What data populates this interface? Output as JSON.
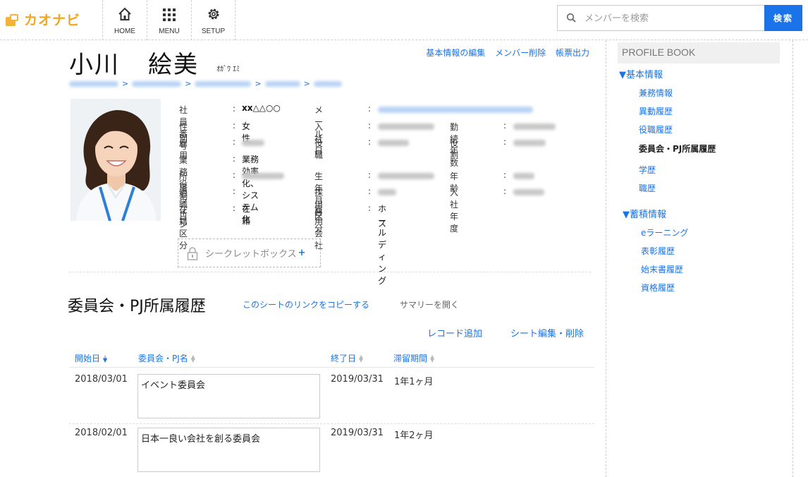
{
  "header": {
    "logo_text": "カオナビ",
    "nav": [
      {
        "label": "HOME",
        "icon": "home-icon"
      },
      {
        "label": "MENU",
        "icon": "grid-icon"
      },
      {
        "label": "SETUP",
        "icon": "gear-icon"
      }
    ],
    "search": {
      "placeholder": "メンバーを検索",
      "value": "",
      "button_label": "検索"
    }
  },
  "profile": {
    "name_family": "小川",
    "name_given": "絵美",
    "name_kana": "ｵｶﾞﾜ ｴﾐ",
    "actions": [
      "基本情報の編集",
      "メンバー削除",
      "帳票出力"
    ],
    "breadcrumb_separator": ">",
    "fields": {
      "employee_no": {
        "label": "社員番号",
        "value": "xx△△○○"
      },
      "email": {
        "label": "メール"
      },
      "gender": {
        "label": "性別",
        "value": "女性"
      },
      "join_date": {
        "label": "入社日"
      },
      "years": {
        "label": "勤続年数"
      },
      "employment": {
        "label": "雇用"
      },
      "position": {
        "label": "役職"
      },
      "role": {
        "label": "役割"
      },
      "duty": {
        "label": "業務役割",
        "value": "業務効率化、システム化"
      },
      "line": {
        "label": "所属ライン"
      },
      "birthday": {
        "label": "生年月日"
      },
      "age": {
        "label": "年齢"
      },
      "retire": {
        "label": "退職日",
        "value": ""
      },
      "hire_type": {
        "label": "採用区分"
      },
      "join_year": {
        "label": "入社年度"
      },
      "status": {
        "label": "在籍区分",
        "value": "在籍"
      },
      "company": {
        "label": "雇用会社",
        "value_line1": "ホールディング",
        "value_line2": "ス"
      }
    },
    "colon": ":",
    "secret_box": {
      "label": "シークレットボックス",
      "plus": "+"
    }
  },
  "sheet": {
    "title": "委員会・PJ所属履歴",
    "copy_link": "このシートのリンクをコピーする",
    "summary": "サマリーを開く",
    "add_record": "レコード追加",
    "edit_sheet": "シート編集・削除",
    "columns": [
      "開始日",
      "委員会・PJ名",
      "終了日",
      "滞留期間"
    ],
    "rows": [
      {
        "start": "2018/03/01",
        "name": "イベント委員会",
        "end": "2019/03/31",
        "duration": "1年1ヶ月"
      },
      {
        "start": "2018/02/01",
        "name": "日本一良い会社を創る委員会",
        "end": "2019/03/31",
        "duration": "1年2ヶ月"
      }
    ]
  },
  "sidebar": {
    "title": "PROFILE BOOK",
    "groups": [
      {
        "label": "▼基本情報",
        "items": [
          "兼務情報",
          "異動履歴",
          "役職履歴",
          "委員会・PJ所属履歴",
          "学歴",
          "職歴"
        ]
      },
      {
        "label": "▼蓄積情報",
        "items": [
          "eラーニング",
          "表彰履歴",
          "始末書履歴",
          "資格履歴"
        ]
      }
    ],
    "active_item": "委員会・PJ所属履歴"
  },
  "colors": {
    "accent": "#1a73e8",
    "brand": "#f2a521"
  }
}
